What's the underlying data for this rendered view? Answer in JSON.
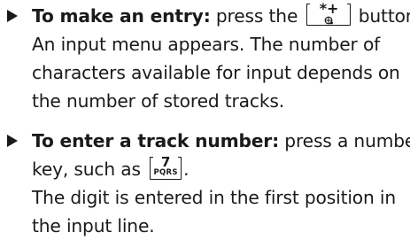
{
  "entry": {
    "bold_label": "To make an entry:",
    "text_pre_key": " press the ",
    "key_symbol": "*+",
    "key_icon": "globe-plus-icon",
    "text_post_key": " button.",
    "line2": "An input menu appears. The number of",
    "line3": "characters available for input depends on",
    "line4": "the number of stored tracks."
  },
  "track": {
    "bold_label": "To enter a track number:",
    "text_after_label": " press a number",
    "text_pre_key": "key, such as ",
    "key_digit": "7",
    "key_letters": "PQRS",
    "text_post_key": ".",
    "line3": "The digit is entered in the first position in",
    "line4": "the input line."
  },
  "colors": {
    "text": "#1a1a1a",
    "background": "#ffffff"
  }
}
